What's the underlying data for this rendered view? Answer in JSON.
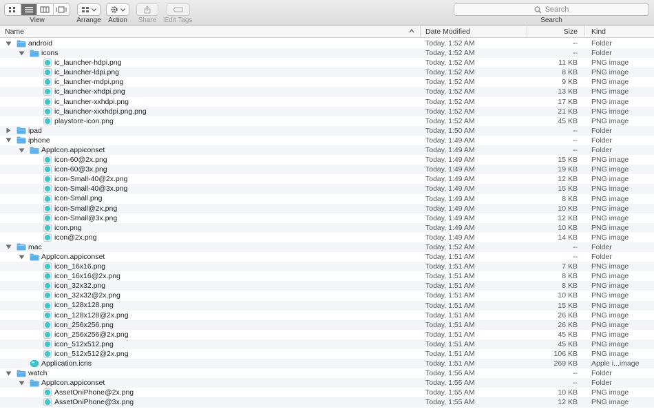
{
  "toolbar": {
    "view_label": "View",
    "arrange_label": "Arrange",
    "action_label": "Action",
    "share_label": "Share",
    "edit_tags_label": "Edit Tags",
    "search_placeholder": "Search",
    "search_label": "Search"
  },
  "columns": {
    "name": "Name",
    "date": "Date Modified",
    "size": "Size",
    "kind": "Kind"
  },
  "rows": [
    {
      "name": "android",
      "depth": 0,
      "type": "folder",
      "disclosure": "open",
      "date": "Today, 1:52 AM",
      "size": "--",
      "kind": "Folder"
    },
    {
      "name": "icons",
      "depth": 1,
      "type": "folder",
      "disclosure": "open",
      "date": "Today, 1:52 AM",
      "size": "--",
      "kind": "Folder"
    },
    {
      "name": "ic_launcher-hdpi.png",
      "depth": 2,
      "type": "png",
      "disclosure": "none",
      "date": "Today, 1:52 AM",
      "size": "11 KB",
      "kind": "PNG image"
    },
    {
      "name": "ic_launcher-ldpi.png",
      "depth": 2,
      "type": "png",
      "disclosure": "none",
      "date": "Today, 1:52 AM",
      "size": "8 KB",
      "kind": "PNG image"
    },
    {
      "name": "ic_launcher-mdpi.png",
      "depth": 2,
      "type": "png",
      "disclosure": "none",
      "date": "Today, 1:52 AM",
      "size": "9 KB",
      "kind": "PNG image"
    },
    {
      "name": "ic_launcher-xhdpi.png",
      "depth": 2,
      "type": "png",
      "disclosure": "none",
      "date": "Today, 1:52 AM",
      "size": "13 KB",
      "kind": "PNG image"
    },
    {
      "name": "ic_launcher-xxhdpi.png",
      "depth": 2,
      "type": "png",
      "disclosure": "none",
      "date": "Today, 1:52 AM",
      "size": "17 KB",
      "kind": "PNG image"
    },
    {
      "name": "ic_launcher-xxxhdpi.png.png",
      "depth": 2,
      "type": "png",
      "disclosure": "none",
      "date": "Today, 1:52 AM",
      "size": "21 KB",
      "kind": "PNG image"
    },
    {
      "name": "playstore-icon.png",
      "depth": 2,
      "type": "png",
      "disclosure": "none",
      "date": "Today, 1:52 AM",
      "size": "45 KB",
      "kind": "PNG image"
    },
    {
      "name": "ipad",
      "depth": 0,
      "type": "folder",
      "disclosure": "closed",
      "date": "Today, 1:50 AM",
      "size": "--",
      "kind": "Folder"
    },
    {
      "name": "iphone",
      "depth": 0,
      "type": "folder",
      "disclosure": "open",
      "date": "Today, 1:49 AM",
      "size": "--",
      "kind": "Folder"
    },
    {
      "name": "AppIcon.appiconset",
      "depth": 1,
      "type": "folder",
      "disclosure": "open",
      "date": "Today, 1:49 AM",
      "size": "--",
      "kind": "Folder"
    },
    {
      "name": "icon-60@2x.png",
      "depth": 2,
      "type": "png",
      "disclosure": "none",
      "date": "Today, 1:49 AM",
      "size": "15 KB",
      "kind": "PNG image"
    },
    {
      "name": "icon-60@3x.png",
      "depth": 2,
      "type": "png",
      "disclosure": "none",
      "date": "Today, 1:49 AM",
      "size": "19 KB",
      "kind": "PNG image"
    },
    {
      "name": "icon-Small-40@2x.png",
      "depth": 2,
      "type": "png",
      "disclosure": "none",
      "date": "Today, 1:49 AM",
      "size": "12 KB",
      "kind": "PNG image"
    },
    {
      "name": "icon-Small-40@3x.png",
      "depth": 2,
      "type": "png",
      "disclosure": "none",
      "date": "Today, 1:49 AM",
      "size": "15 KB",
      "kind": "PNG image"
    },
    {
      "name": "icon-Small.png",
      "depth": 2,
      "type": "png",
      "disclosure": "none",
      "date": "Today, 1:49 AM",
      "size": "8 KB",
      "kind": "PNG image"
    },
    {
      "name": "icon-Small@2x.png",
      "depth": 2,
      "type": "png",
      "disclosure": "none",
      "date": "Today, 1:49 AM",
      "size": "10 KB",
      "kind": "PNG image"
    },
    {
      "name": "icon-Small@3x.png",
      "depth": 2,
      "type": "png",
      "disclosure": "none",
      "date": "Today, 1:49 AM",
      "size": "12 KB",
      "kind": "PNG image"
    },
    {
      "name": "icon.png",
      "depth": 2,
      "type": "png",
      "disclosure": "none",
      "date": "Today, 1:49 AM",
      "size": "10 KB",
      "kind": "PNG image"
    },
    {
      "name": "icon@2x.png",
      "depth": 2,
      "type": "png",
      "disclosure": "none",
      "date": "Today, 1:49 AM",
      "size": "14 KB",
      "kind": "PNG image"
    },
    {
      "name": "mac",
      "depth": 0,
      "type": "folder",
      "disclosure": "open",
      "date": "Today, 1:52 AM",
      "size": "--",
      "kind": "Folder"
    },
    {
      "name": "AppIcon.appiconset",
      "depth": 1,
      "type": "folder",
      "disclosure": "open",
      "date": "Today, 1:51 AM",
      "size": "--",
      "kind": "Folder"
    },
    {
      "name": "icon_16x16.png",
      "depth": 2,
      "type": "png",
      "disclosure": "none",
      "date": "Today, 1:51 AM",
      "size": "7 KB",
      "kind": "PNG image"
    },
    {
      "name": "icon_16x16@2x.png",
      "depth": 2,
      "type": "png",
      "disclosure": "none",
      "date": "Today, 1:51 AM",
      "size": "8 KB",
      "kind": "PNG image"
    },
    {
      "name": "icon_32x32.png",
      "depth": 2,
      "type": "png",
      "disclosure": "none",
      "date": "Today, 1:51 AM",
      "size": "8 KB",
      "kind": "PNG image"
    },
    {
      "name": "icon_32x32@2x.png",
      "depth": 2,
      "type": "png",
      "disclosure": "none",
      "date": "Today, 1:51 AM",
      "size": "10 KB",
      "kind": "PNG image"
    },
    {
      "name": "icon_128x128.png",
      "depth": 2,
      "type": "png",
      "disclosure": "none",
      "date": "Today, 1:51 AM",
      "size": "15 KB",
      "kind": "PNG image"
    },
    {
      "name": "icon_128x128@2x.png",
      "depth": 2,
      "type": "png",
      "disclosure": "none",
      "date": "Today, 1:51 AM",
      "size": "26 KB",
      "kind": "PNG image"
    },
    {
      "name": "icon_256x256.png",
      "depth": 2,
      "type": "png",
      "disclosure": "none",
      "date": "Today, 1:51 AM",
      "size": "26 KB",
      "kind": "PNG image"
    },
    {
      "name": "icon_256x256@2x.png",
      "depth": 2,
      "type": "png",
      "disclosure": "none",
      "date": "Today, 1:51 AM",
      "size": "45 KB",
      "kind": "PNG image"
    },
    {
      "name": "icon_512x512.png",
      "depth": 2,
      "type": "png",
      "disclosure": "none",
      "date": "Today, 1:51 AM",
      "size": "45 KB",
      "kind": "PNG image"
    },
    {
      "name": "icon_512x512@2x.png",
      "depth": 2,
      "type": "png",
      "disclosure": "none",
      "date": "Today, 1:51 AM",
      "size": "106 KB",
      "kind": "PNG image"
    },
    {
      "name": "Application.icns",
      "depth": 1,
      "type": "icns",
      "disclosure": "none",
      "date": "Today, 1:51 AM",
      "size": "269 KB",
      "kind": "Apple i...image"
    },
    {
      "name": "watch",
      "depth": 0,
      "type": "folder",
      "disclosure": "open",
      "date": "Today, 1:56 AM",
      "size": "--",
      "kind": "Folder"
    },
    {
      "name": "AppIcon.appiconset",
      "depth": 1,
      "type": "folder",
      "disclosure": "open",
      "date": "Today, 1:55 AM",
      "size": "--",
      "kind": "Folder"
    },
    {
      "name": "AssetOniPhone@2x.png",
      "depth": 2,
      "type": "png",
      "disclosure": "none",
      "date": "Today, 1:55 AM",
      "size": "10 KB",
      "kind": "PNG image"
    },
    {
      "name": "AssetOniPhone@3x.png",
      "depth": 2,
      "type": "png",
      "disclosure": "none",
      "date": "Today, 1:55 AM",
      "size": "12 KB",
      "kind": "PNG image"
    }
  ],
  "colors": {
    "folder": "#5eb0ea",
    "png": "#3ec3c8",
    "alt_row": "#f3f5f8"
  }
}
